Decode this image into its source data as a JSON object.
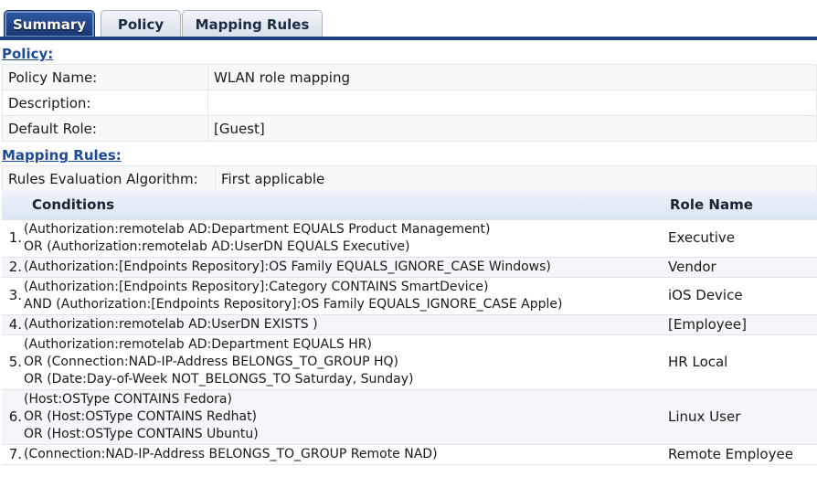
{
  "tabs": [
    {
      "label": "Summary",
      "active": true
    },
    {
      "label": "Policy",
      "active": false
    },
    {
      "label": "Mapping Rules",
      "active": false
    }
  ],
  "policy_section": {
    "title": "Policy:",
    "fields": [
      {
        "label": "Policy Name:",
        "value": "WLAN role mapping"
      },
      {
        "label": "Description:",
        "value": ""
      },
      {
        "label": "Default Role:",
        "value": "[Guest]"
      }
    ]
  },
  "mapping_section": {
    "title": "Mapping Rules:",
    "algorithm_label": "Rules Evaluation Algorithm:",
    "algorithm_value": "First applicable",
    "columns": {
      "conditions": "Conditions",
      "role": "Role Name"
    },
    "rows": [
      {
        "num": "1.",
        "lines": [
          "(Authorization:remotelab AD:Department EQUALS Product Management)",
          "OR (Authorization:remotelab AD:UserDN EQUALS Executive)"
        ],
        "role": "Executive"
      },
      {
        "num": "2.",
        "lines": [
          "(Authorization:[Endpoints Repository]:OS Family EQUALS_IGNORE_CASE Windows)"
        ],
        "role": "Vendor"
      },
      {
        "num": "3.",
        "lines": [
          "(Authorization:[Endpoints Repository]:Category CONTAINS SmartDevice)",
          "AND (Authorization:[Endpoints Repository]:OS Family EQUALS_IGNORE_CASE Apple)"
        ],
        "role": "iOS Device"
      },
      {
        "num": "4.",
        "lines": [
          "(Authorization:remotelab AD:UserDN EXISTS  )"
        ],
        "role": "[Employee]"
      },
      {
        "num": "5.",
        "lines": [
          "(Authorization:remotelab AD:Department EQUALS HR)",
          "OR (Connection:NAD-IP-Address BELONGS_TO_GROUP HQ)",
          "OR (Date:Day-of-Week NOT_BELONGS_TO Saturday, Sunday)"
        ],
        "role": "HR Local"
      },
      {
        "num": "6.",
        "lines": [
          "(Host:OSType CONTAINS Fedora)",
          "OR (Host:OSType CONTAINS Redhat)",
          "OR (Host:OSType CONTAINS Ubuntu)"
        ],
        "role": "Linux User"
      },
      {
        "num": "7.",
        "lines": [
          "(Connection:NAD-IP-Address BELONGS_TO_GROUP Remote NAD)"
        ],
        "role": "Remote Employee"
      }
    ]
  }
}
